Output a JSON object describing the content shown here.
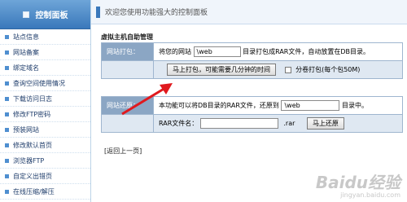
{
  "sidebar": {
    "title": "控制面板",
    "items": [
      {
        "label": "站点信息"
      },
      {
        "label": "网站备案"
      },
      {
        "label": "绑定域名"
      },
      {
        "label": "查询空间使用情况"
      },
      {
        "label": "下载访问日志"
      },
      {
        "label": "修改FTP密码"
      },
      {
        "label": "预装网站"
      },
      {
        "label": "修改默认首页"
      },
      {
        "label": "浏览器FTP"
      },
      {
        "label": "自定义出错页"
      },
      {
        "label": "在线压缩/解压"
      }
    ]
  },
  "topbar": {
    "welcome": "欢迎您使用功能强大的控制面板"
  },
  "main": {
    "section_title": "虚拟主机自助管理",
    "pack": {
      "label": "网站打包：",
      "prefix": "将您的网站",
      "dir_value": "\\web",
      "suffix": "目录打包成RAR文件，自动放置在DB目录。",
      "button": "马上打包，可能需要几分钟的时间",
      "split_label": "分卷打包(每个包50M)"
    },
    "restore": {
      "label": "网站还原：",
      "prefix": "本功能可以将DB目录的RAR文件，还原到",
      "dir_value": "\\web",
      "suffix": "目录中。",
      "rar_label": "RAR文件名：",
      "rar_value": "",
      "ext": ".rar",
      "button": "马上还原"
    },
    "back_link": "[返回上一页]"
  },
  "watermark": {
    "brand": "Baidu经验",
    "url": "jingyan.baidu.com"
  },
  "colors": {
    "arrow": "#e0191e",
    "header": "#3a78bb",
    "label_bg": "#8ba6c4"
  }
}
